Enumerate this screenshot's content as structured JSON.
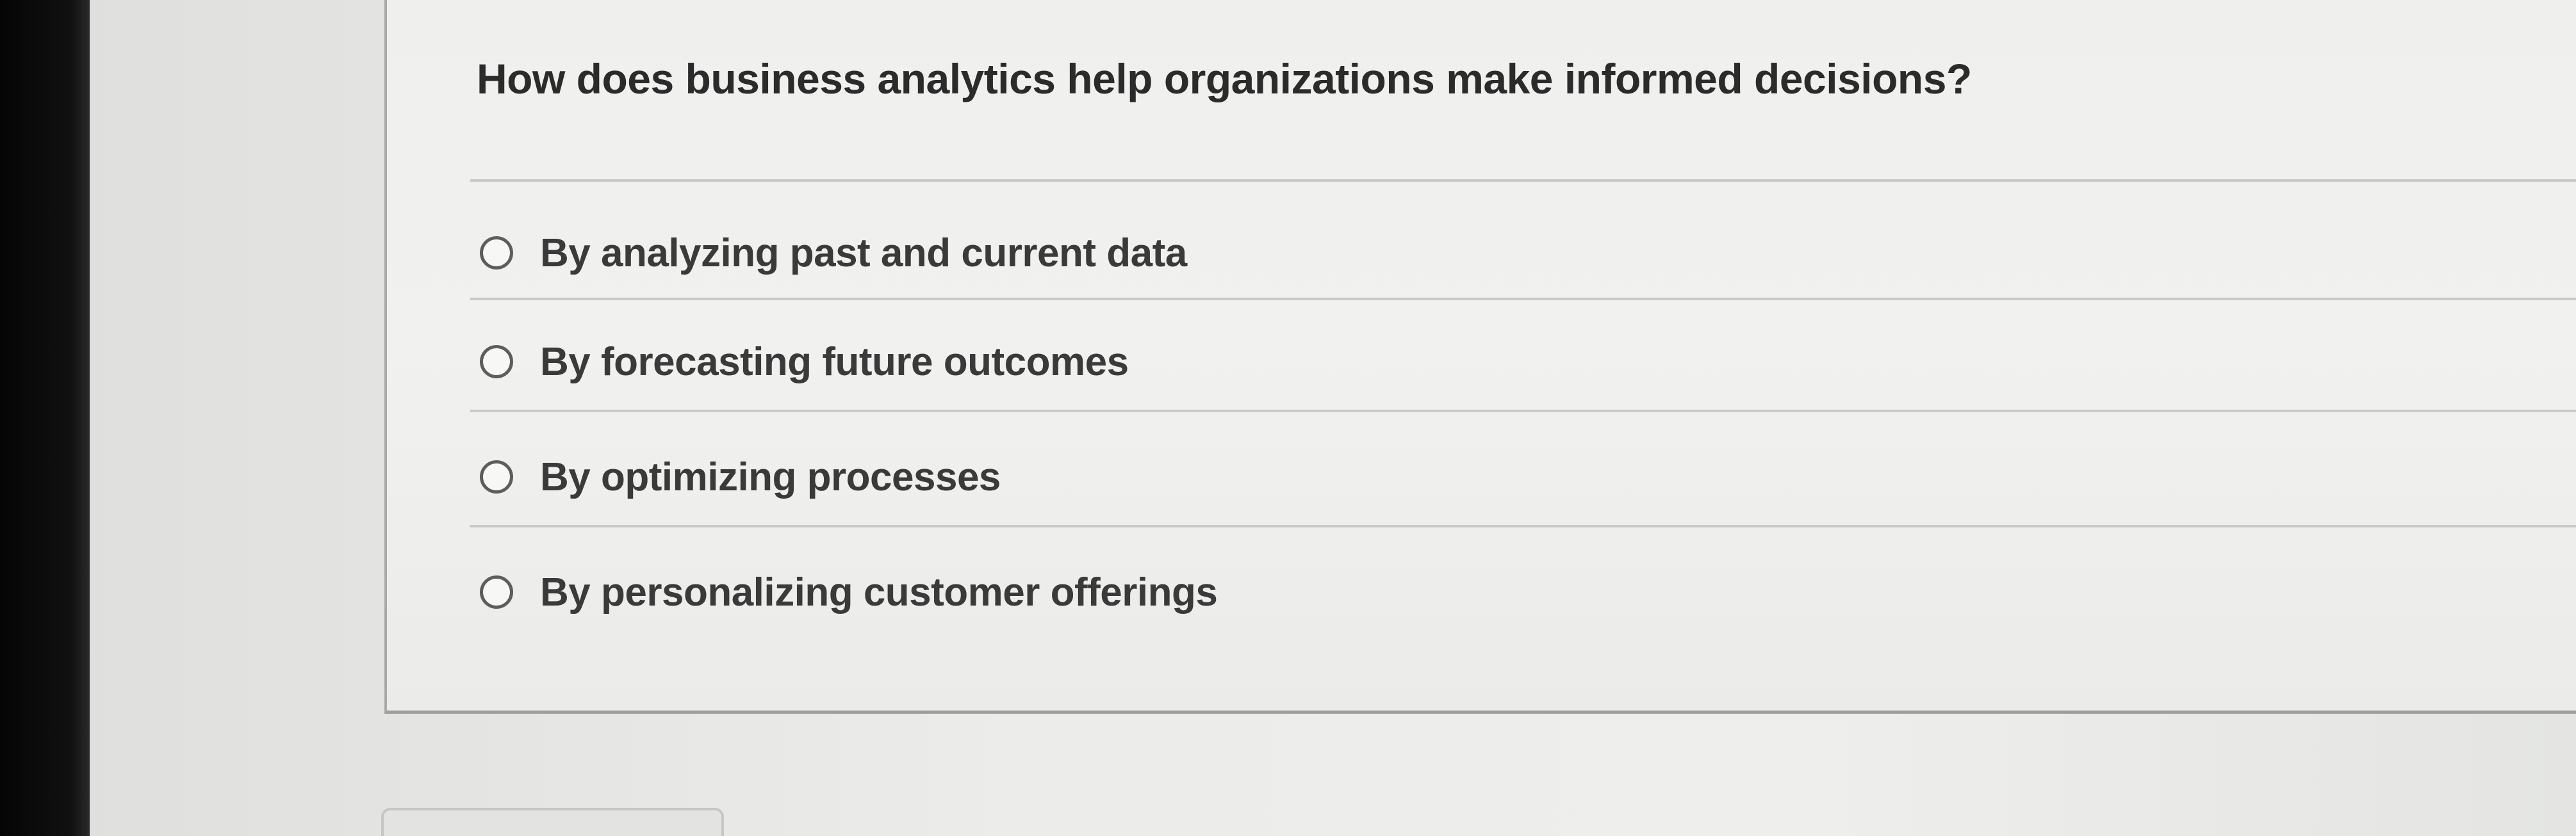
{
  "quiz": {
    "question": "How does business analytics help organizations make informed decisions?",
    "options": [
      {
        "label": "By analyzing past and current data",
        "selected": false
      },
      {
        "label": "By forecasting future outcomes",
        "selected": false
      },
      {
        "label": "By optimizing processes",
        "selected": false
      },
      {
        "label": "By personalizing customer offerings",
        "selected": false
      }
    ]
  }
}
